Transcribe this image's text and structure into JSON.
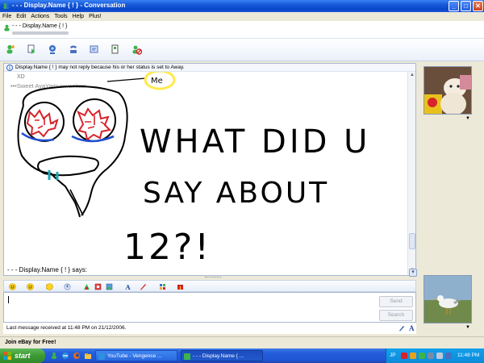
{
  "window": {
    "title": "- - -  Display.Name { ! } - Conversation",
    "minimize": "_",
    "maximize": "□",
    "close": "✕"
  },
  "menu": [
    "File",
    "Edit",
    "Actions",
    "Tools",
    "Help",
    "Plus!"
  ],
  "contact": {
    "name": "- - -  Display.Name { ! }"
  },
  "toolbar": {
    "icons": [
      "invite-icon",
      "send-files-icon",
      "webcam-icon",
      "voice-icon",
      "activities-icon",
      "games-icon",
      "block-icon"
    ]
  },
  "history": {
    "info": "Display.Name { ! } may not reply because his or her status is set to Away.",
    "xd": "XD",
    "writes_prefix": "•••Sweet AyaYamu•••",
    "writes_suffix": " writes:",
    "me_label": "Me",
    "handwriting": [
      "WHAT DID U",
      "SAY ABOUT",
      "12?!"
    ],
    "says": "- - -   Display.Name { ! } says:"
  },
  "input": {
    "send_label": "Send",
    "search_label": "Search",
    "last_message": "Last message received at 11:48 PM on 21/12/2006.",
    "font_label": "A"
  },
  "ad": {
    "text": "Join eBay for Free!"
  },
  "taskbar": {
    "start": "start",
    "tasks": [
      {
        "label": "YouTube - Vengence ...",
        "active": false
      },
      {
        "label": "- - -  Display.Name { ...",
        "active": true
      }
    ],
    "tray_lang": "JP",
    "clock": "11:48 PM"
  },
  "colors": {
    "title_blue": "#0a45c8",
    "taskbar_blue": "#245edb",
    "start_green": "#3b9a34",
    "me_highlight": "#ffe94a",
    "brain_red": "#d9232a",
    "tear_blue": "#1f4fd0",
    "drool_teal": "#1aa9b8"
  }
}
